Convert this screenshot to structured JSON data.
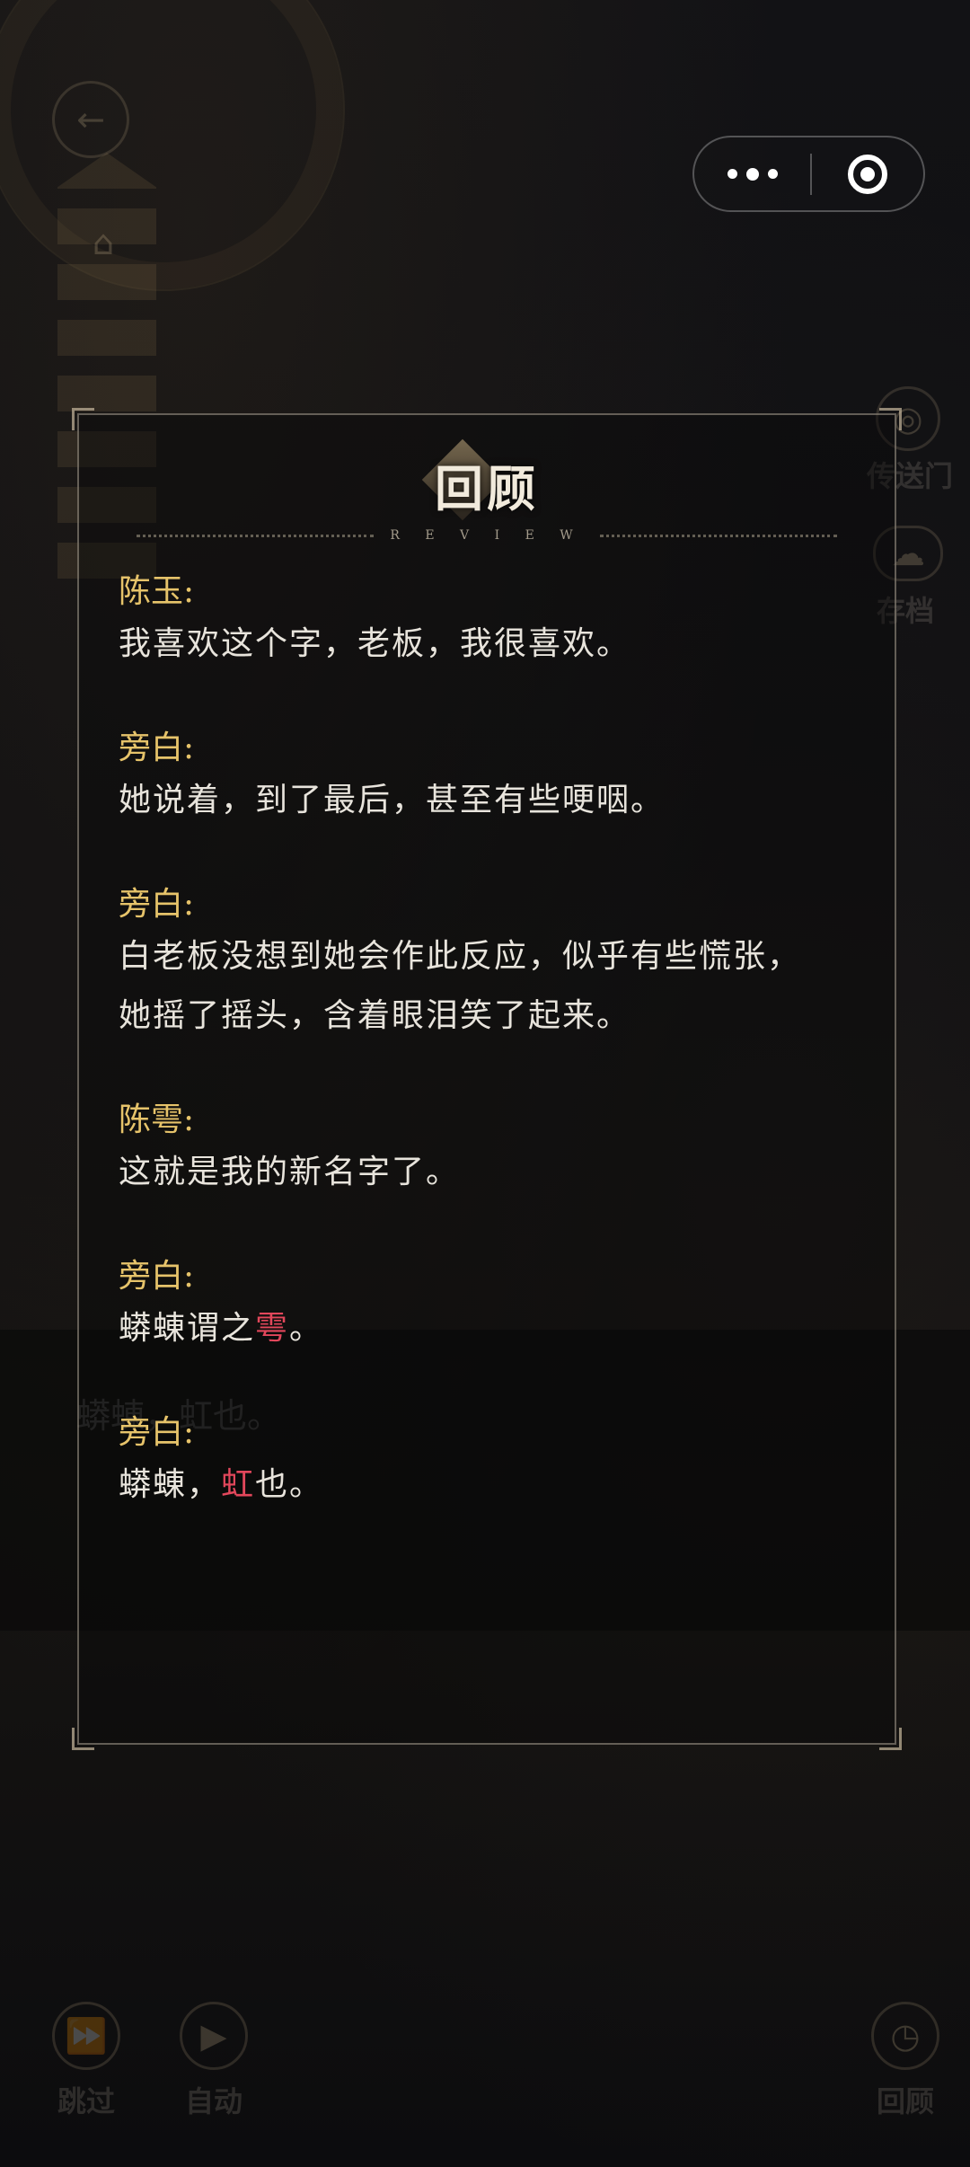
{
  "background": {
    "ghost_text": "蟒蝀，虹也。",
    "side_buttons": [
      {
        "icon": "portal-icon",
        "label": "传送门"
      },
      {
        "icon": "cloud-save-icon",
        "label": "存档"
      }
    ],
    "bottom_controls": [
      {
        "icon": "skip-icon",
        "label": "跳过"
      },
      {
        "icon": "play-icon",
        "label": "自动"
      },
      {
        "icon": "clock-icon",
        "label": "回顾"
      }
    ]
  },
  "capsule": {
    "more_icon": "more-dots-icon",
    "close_icon": "target-close-icon"
  },
  "panel": {
    "title": "回顾",
    "subtitle": "R E V I E W",
    "entries": [
      {
        "speaker": "陈玉:",
        "lines": [
          "我喜欢这个字，老板，我很喜欢。"
        ]
      },
      {
        "speaker": "旁白:",
        "lines": [
          "她说着，到了最后，甚至有些哽咽。"
        ]
      },
      {
        "speaker": "旁白:",
        "lines": [
          "白老板没想到她会作此反应，似乎有些慌张，",
          "她摇了摇头，含着眼泪笑了起来。"
        ]
      },
      {
        "speaker": "陈雩:",
        "lines": [
          "这就是我的新名字了。"
        ]
      },
      {
        "speaker": "旁白:",
        "before": "蟒蝀谓之",
        "highlight": "雩",
        "after": "。"
      },
      {
        "speaker": "旁白:",
        "before": "蟒蝀，",
        "highlight": "虹",
        "after": "也。"
      }
    ],
    "highlight_color": "#e2475b",
    "speaker_color": "#e6c36a"
  }
}
